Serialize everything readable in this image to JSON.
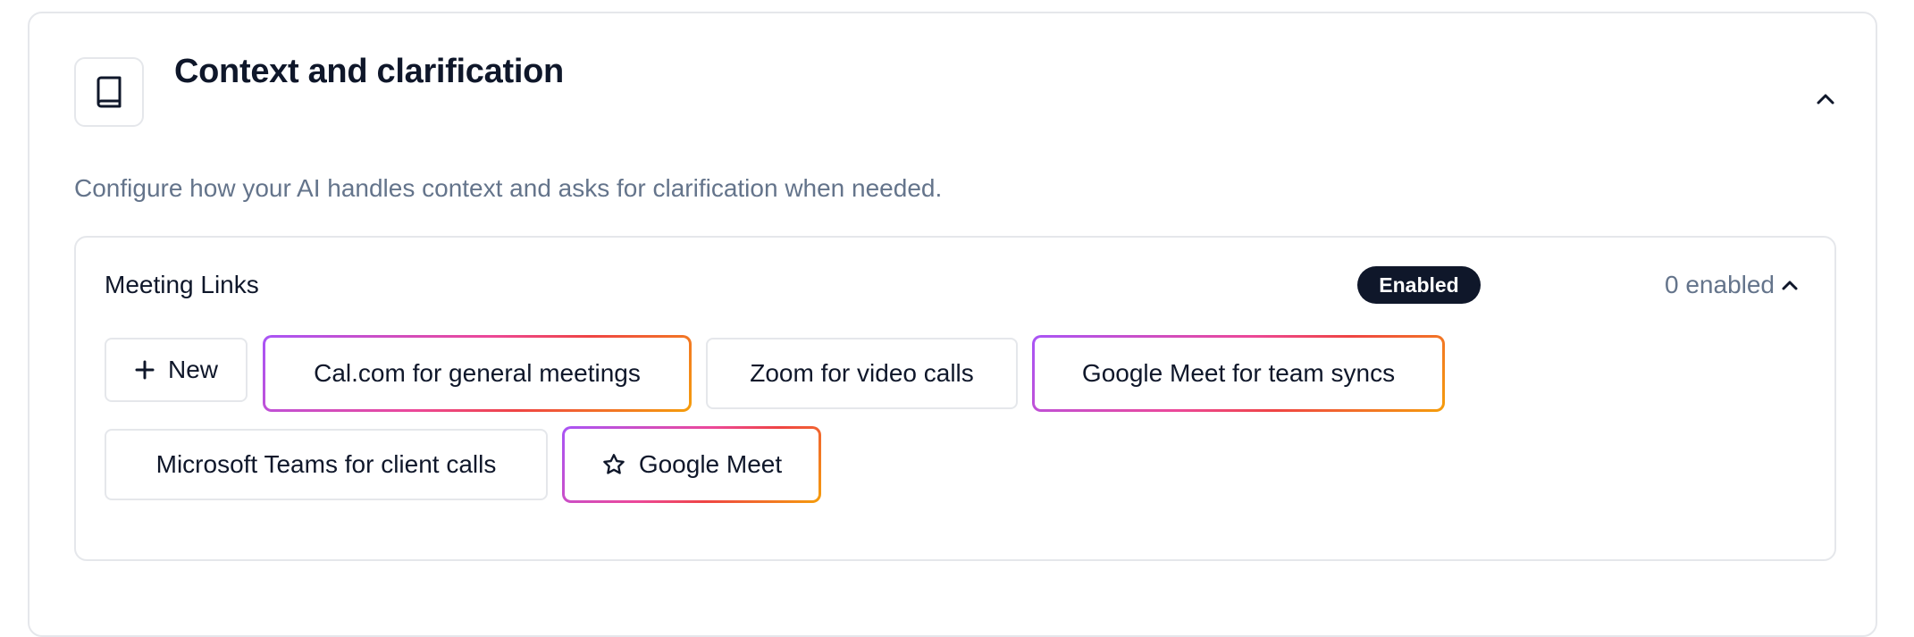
{
  "section": {
    "title": "Context and clarification",
    "description": "Configure how your AI handles context and asks for clarification when needed.",
    "icon": "book-icon",
    "collapse_icon": "chevron-up-icon"
  },
  "meeting_links": {
    "title": "Meeting Links",
    "badge": "Enabled",
    "count_label": "0 enabled",
    "new_label": "New",
    "chips": [
      {
        "label": "Cal.com for general meetings",
        "highlighted": true
      },
      {
        "label": "Zoom for video calls",
        "highlighted": false
      },
      {
        "label": "Google Meet for team syncs",
        "highlighted": true
      },
      {
        "label": "Microsoft Teams for client calls",
        "highlighted": false
      },
      {
        "label": "Google Meet",
        "highlighted": true,
        "icon": "star-icon"
      }
    ]
  },
  "colors": {
    "text_primary": "#0f172a",
    "text_muted": "#64748b",
    "border": "#e5e7eb",
    "badge_bg": "#0f172a",
    "gradient": [
      "#a855f7",
      "#ec4899",
      "#ef4444",
      "#f59e0b"
    ]
  }
}
